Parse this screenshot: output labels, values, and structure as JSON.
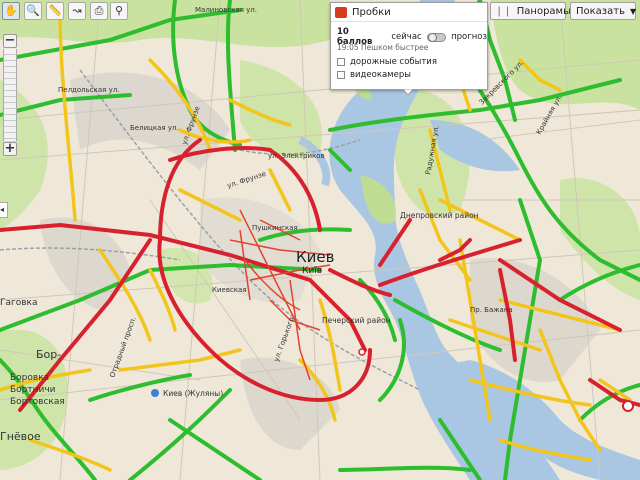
{
  "toolbar": {
    "tools": [
      {
        "name": "hand-tool-icon",
        "glyph": "✋"
      },
      {
        "name": "magnifier-tool-icon",
        "glyph": "🔍"
      },
      {
        "name": "ruler-tool-icon",
        "glyph": "📏"
      },
      {
        "name": "route-tool-icon",
        "glyph": "↝"
      },
      {
        "name": "print-tool-icon",
        "glyph": "⎙"
      },
      {
        "name": "link-tool-icon",
        "glyph": "⚲"
      }
    ],
    "panoramas_label": "Панорамы",
    "show_label": "Показать"
  },
  "zoom": {
    "plus": "+",
    "minus": "−"
  },
  "traffic": {
    "title": "Пробки",
    "score": "10 баллов",
    "now_label": "сейчас",
    "forecast_label": "прогноз",
    "status": "19:05 Пешком быстрее",
    "options": [
      "дорожные события",
      "видеокамеры"
    ],
    "color": "#d63a1f"
  },
  "map": {
    "city_label": "Киев",
    "city_label_ua": "Київ",
    "labels": [
      "ул. Фрунзе",
      "ул. Электриков",
      "Белицкая ул.",
      "Днепровский район",
      "Печерский район",
      "Киев (Жуляны)",
      "Отрадный просп.",
      "ул. Фрунзе",
      "Радужная ул.",
      "ул. Горького",
      "Пелдольская ул.",
      "Бор-",
      "Крайняя ул.",
      "Закревского ул.",
      "Гаговка",
      "Боровка",
      "Бортничи",
      "Бортовская",
      "Гнёвое",
      "Малиновская ул.",
      "Пр. Бажана",
      "Киевская",
      "Пушкинская"
    ],
    "colors": {
      "green": "#2ebd2e",
      "yellow": "#f3c51c",
      "red": "#d8212e",
      "water": "#a9c7e3",
      "park": "#bfdc93",
      "land": "#efe8d8"
    }
  }
}
